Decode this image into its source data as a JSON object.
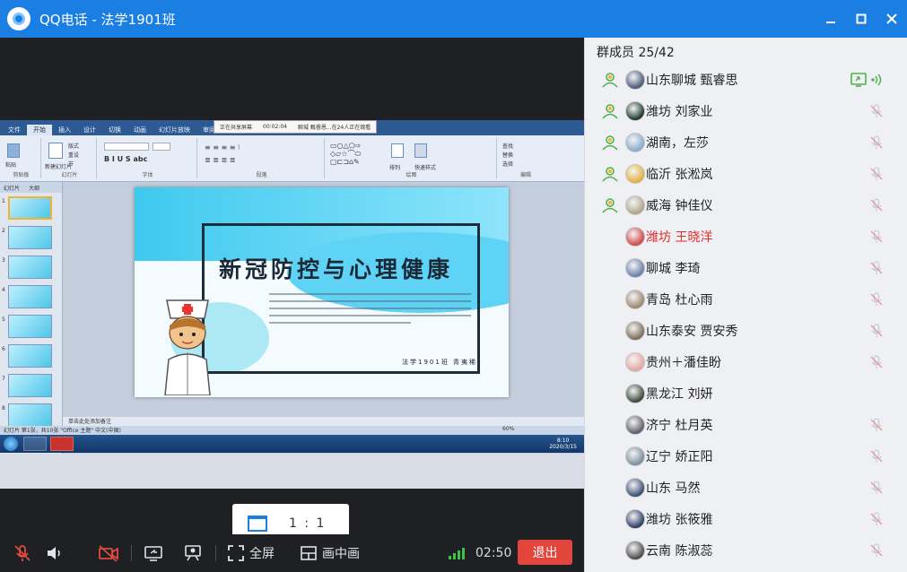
{
  "window": {
    "app_name": "QQ电话",
    "separator": " - ",
    "group_name": "法学1901班",
    "title": "QQ电话 - 法学1901班"
  },
  "screen_share": {
    "ppt_tabs": [
      "文件",
      "开始",
      "插入",
      "设计",
      "切换",
      "动画",
      "幻灯片放映",
      "审阅",
      "视图"
    ],
    "float_tabs": [
      "正在共享屏幕",
      "00:02:04",
      "聊城 甄睿恩...在24人正在观看"
    ],
    "ribbon_groups": [
      "剪贴板",
      "幻灯片",
      "字体",
      "段落",
      "绘图",
      "编辑"
    ],
    "ribbon_buttons": [
      "粘贴",
      "新建幻灯片",
      "版式",
      "重设",
      "节",
      "形状",
      "排列",
      "快速样式",
      "查找",
      "替换",
      "选择"
    ],
    "pane_tabs": [
      "幻灯片",
      "大纲"
    ],
    "slide_title": "新冠防控与心理健康",
    "slide_signature": "法学1901班 青夷稀",
    "notes_placeholder": "单击此处添加备注",
    "status_text": "幻灯片 第1张，共10张   \"Office 主题\"   中文(中国)",
    "zoom": "60%",
    "clock_time": "8:10",
    "clock_date": "2020/3/15",
    "thumbnail_count": 8
  },
  "view_ratio": {
    "label": "1 : 1",
    "icon": "window-icon"
  },
  "toolbar": {
    "mic_icon": "mic-muted-icon",
    "speaker_icon": "speaker-icon",
    "camera_icon": "camera-off-icon",
    "share_screen_icon": "share-screen-icon",
    "play_icon": "presenter-icon",
    "fullscreen_label": "全屏",
    "pip_label": "画中画",
    "timer": "02:50",
    "exit_label": "退出",
    "signal_color": "#3ec24a",
    "exit_color": "#e2453c"
  },
  "members": {
    "header": "群成员 25/42",
    "list": [
      {
        "name": "山东聊城 甄睿思",
        "role": "admin",
        "status": "sharing",
        "name_color": "normal"
      },
      {
        "name": "潍坊 刘家业",
        "role": "admin",
        "status": "muted",
        "name_color": "normal"
      },
      {
        "name": "湖南，左莎",
        "role": "admin",
        "status": "muted",
        "name_color": "normal"
      },
      {
        "name": "临沂 张淞岚",
        "role": "admin",
        "status": "muted",
        "name_color": "normal"
      },
      {
        "name": "威海  钟佳仪",
        "role": "admin",
        "status": "muted",
        "name_color": "normal"
      },
      {
        "name": "潍坊 王晓洋",
        "role": "none",
        "status": "muted",
        "name_color": "red"
      },
      {
        "name": "聊城 李琦",
        "role": "none",
        "status": "muted",
        "name_color": "normal"
      },
      {
        "name": "青岛   杜心雨",
        "role": "none",
        "status": "muted",
        "name_color": "normal"
      },
      {
        "name": "山东泰安 贾安秀",
        "role": "none",
        "status": "muted",
        "name_color": "normal"
      },
      {
        "name": "贵州＋潘佳盼",
        "role": "none",
        "status": "muted",
        "name_color": "normal"
      },
      {
        "name": "黑龙江 刘妍",
        "role": "none",
        "status": "none",
        "name_color": "normal"
      },
      {
        "name": "济宁 杜月英",
        "role": "none",
        "status": "muted",
        "name_color": "normal"
      },
      {
        "name": "辽宁 娇正阳",
        "role": "none",
        "status": "muted",
        "name_color": "normal"
      },
      {
        "name": "山东 马然",
        "role": "none",
        "status": "muted",
        "name_color": "normal"
      },
      {
        "name": "潍坊  张筱雅",
        "role": "none",
        "status": "muted",
        "name_color": "normal"
      },
      {
        "name": "云南      陈淑蕊",
        "role": "none",
        "status": "muted",
        "name_color": "normal"
      }
    ],
    "accent_green": "#52b04e",
    "red_name_color": "#e22b2b"
  }
}
